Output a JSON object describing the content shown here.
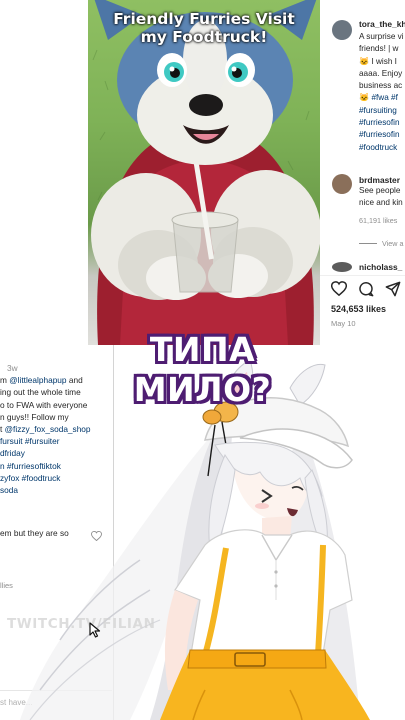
{
  "video": {
    "title_line1": "Friendly Furries Visit",
    "title_line2": "my Foodtruck!"
  },
  "meme_caption": "ТИПА МИЛО?",
  "instagram_top": {
    "author": "tora_the_kh",
    "caption_lines": [
      "A surprise vi",
      "friends! | w",
      "🐱 I wish I",
      "aaaa. Enjoy",
      "business ac",
      "🐱 #fwa #f",
      "#fursuiting",
      "#furriesofin",
      "#furriesofin",
      "#foodtruck"
    ],
    "comment": {
      "author": "brdmaster",
      "lines": [
        "See people",
        "nice and kin"
      ],
      "likes": "61,191 likes"
    },
    "view_replies": "View a",
    "next_author": "nicholass_",
    "likes_count": "524,653 likes",
    "date": "May 10"
  },
  "instagram_lower": {
    "time": "3w",
    "caption_lines": [
      {
        "pre": "m ",
        "link": "@littlealphapup",
        "post": " and"
      },
      {
        "pre": "ing out the whole time",
        "link": "",
        "post": ""
      },
      {
        "pre": "o to FWA with everyone",
        "link": "",
        "post": ""
      },
      {
        "pre": "n guys!! Follow my",
        "link": "",
        "post": ""
      },
      {
        "pre": "t ",
        "link": "@fizzy_fox_soda_shop",
        "post": ""
      },
      {
        "pre": "",
        "link": "fursuit #fursuiter",
        "post": ""
      },
      {
        "pre": "",
        "link": "dfriday",
        "post": ""
      },
      {
        "pre": "",
        "link": "n #furriesoftiktok",
        "post": ""
      },
      {
        "pre": "",
        "link": "zyfox #foodtruck",
        "post": ""
      },
      {
        "pre": "",
        "link": "soda",
        "post": ""
      }
    ],
    "comment": "em but they are so",
    "likes": "llies",
    "footer": "st have..."
  },
  "watermark": "TWITCH.TV/FILIAN",
  "icons": [
    "heart-icon",
    "comment-icon",
    "share-icon",
    "cursor-icon"
  ]
}
